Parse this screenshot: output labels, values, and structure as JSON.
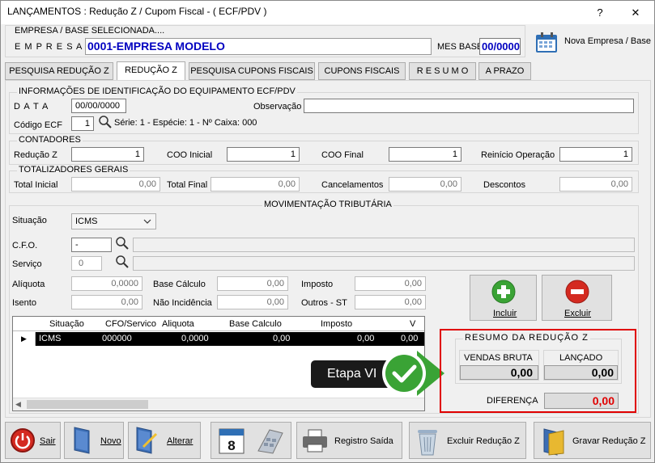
{
  "window": {
    "title": "LANÇAMENTOS : Redução Z / Cupom Fiscal - ( ECF/PDV )",
    "help": "?",
    "close": "✕"
  },
  "empresa": {
    "section_label": "EMPRESA  /  BASE  SELECIONADA....",
    "label": "E M P R E S A",
    "value": "0001-EMPRESA MODELO",
    "mes_base_label": "MES BASE",
    "mes_base_value": "00/0000",
    "nova_empresa": "Nova Empresa / Base"
  },
  "tabs": [
    "PESQUISA REDUÇÃO Z",
    "REDUÇÃO Z",
    "PESQUISA CUPONS FISCAIS",
    "CUPONS FISCAIS",
    "R E S U M O",
    "A PRAZO"
  ],
  "info": {
    "title": "INFORMAÇÕES DE IDENTIFICAÇÃO DO EQUIPAMENTO ECF/PDV",
    "data_label": "D A T A",
    "data_value": "00/00/0000",
    "obs_label": "Observação",
    "obs_value": "",
    "codigo_label": "Código ECF",
    "codigo_value": "1",
    "serie_text": "Série: 1 -  Espécie: 1 -   Nº Caixa: 000"
  },
  "contadores": {
    "title": "CONTADORES",
    "reducao_label": "Redução Z",
    "reducao_value": "1",
    "coo_ini_label": "COO  Inicial",
    "coo_ini_value": "1",
    "coo_fin_label": "COO  Final",
    "coo_fin_value": "1",
    "reinicio_label": "Reinício Operação",
    "reinicio_value": "1"
  },
  "totalizadores": {
    "title": "TOTALIZADORES  GERAIS",
    "total_ini_label": "Total Inicial",
    "total_ini_value": "0,00",
    "total_fin_label": "Total Final",
    "total_fin_value": "0,00",
    "canc_label": "Cancelamentos",
    "canc_value": "0,00",
    "desc_label": "Descontos",
    "desc_value": "0,00"
  },
  "mov": {
    "title": "MOVIMENTAÇÃO TRIBUTÁRIA",
    "situacao_label": "Situação",
    "situacao_value": "ICMS",
    "cfo_label": "C.F.O.",
    "cfo_value": "-",
    "servico_label": "Serviço",
    "servico_value": "0",
    "aliquota_label": "Alíquota",
    "aliquota_value": "0,0000",
    "base_label": "Base Cálculo",
    "base_value": "0,00",
    "imposto_label": "Imposto",
    "imposto_value": "0,00",
    "isento_label": "Isento",
    "isento_value": "0,00",
    "naoinc_label": "Não Incidência",
    "naoinc_value": "0,00",
    "outros_label": "Outros - ST",
    "outros_value": "0,00",
    "incluir": "Incluir",
    "excluir": "Excluir"
  },
  "grid": {
    "columns": [
      "Situação",
      "CFO/Servico",
      "Aliquota",
      "Base Calculo",
      "Imposto",
      "V"
    ],
    "rows": [
      {
        "situacao": "ICMS",
        "cfo": "000000",
        "aliquota": "0,0000",
        "base": "0,00",
        "imposto": "0,00",
        "v": "0,00"
      }
    ]
  },
  "callout": {
    "text": "Etapa VI"
  },
  "resumo": {
    "title": "RESUMO   DA   REDUÇÃO  Z",
    "vendas_label": "VENDAS BRUTA",
    "vendas_value": "0,00",
    "lancado_label": "LANÇADO",
    "lancado_value": "0,00",
    "dif_label": "DIFERENÇA",
    "dif_value": "0,00",
    "dif_color": "#e00000"
  },
  "toolbar": {
    "sair": "Sair",
    "novo": "Novo",
    "alterar": "Alterar",
    "registro": "Registro Saída",
    "excluir": "Excluir Redução Z",
    "gravar": "Gravar Redução Z"
  }
}
